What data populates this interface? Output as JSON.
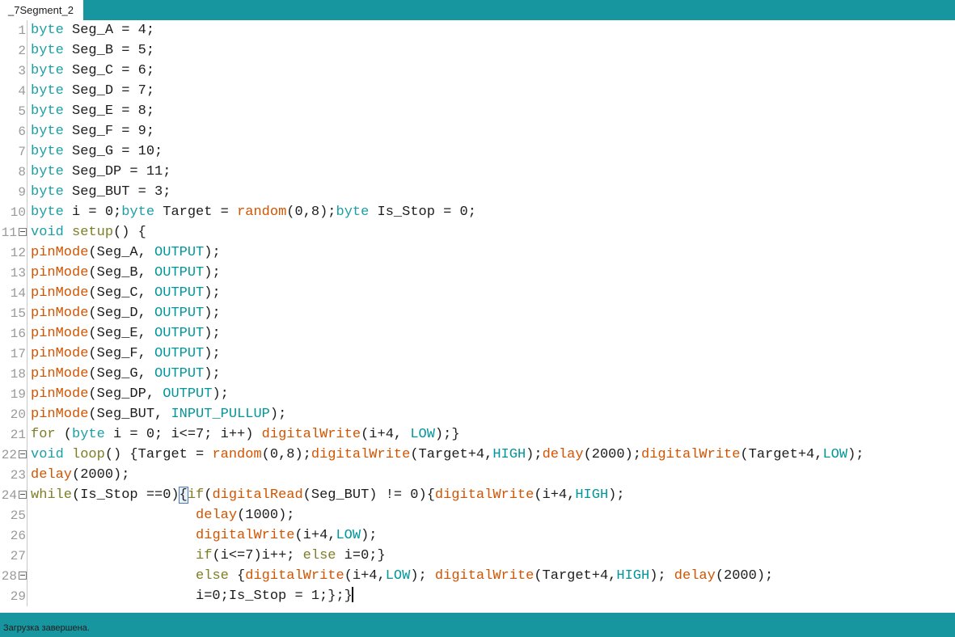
{
  "window": {
    "accent_teal": "#1896a0",
    "background": "#ffffff"
  },
  "tabbar": {
    "tabs": [
      {
        "label": "_7Segment_2",
        "active": true
      }
    ]
  },
  "editor": {
    "font": "monospace",
    "brace_match_highlight": "{",
    "caret_line": 29,
    "lines": [
      {
        "n": "1",
        "fold": false,
        "text": "byte Seg_A = 4;"
      },
      {
        "n": "2",
        "fold": false,
        "text": "byte Seg_B = 5;"
      },
      {
        "n": "3",
        "fold": false,
        "text": "byte Seg_C = 6;"
      },
      {
        "n": "4",
        "fold": false,
        "text": "byte Seg_D = 7;"
      },
      {
        "n": "5",
        "fold": false,
        "text": "byte Seg_E = 8;"
      },
      {
        "n": "6",
        "fold": false,
        "text": "byte Seg_F = 9;"
      },
      {
        "n": "7",
        "fold": false,
        "text": "byte Seg_G = 10;"
      },
      {
        "n": "8",
        "fold": false,
        "text": "byte Seg_DP = 11;"
      },
      {
        "n": "9",
        "fold": false,
        "text": "byte Seg_BUT = 3;"
      },
      {
        "n": "10",
        "fold": false,
        "text": "byte i = 0;byte Target = random(0,8);byte Is_Stop = 0;"
      },
      {
        "n": "11",
        "fold": true,
        "text": "void setup() {"
      },
      {
        "n": "12",
        "fold": false,
        "text": "pinMode(Seg_A, OUTPUT);"
      },
      {
        "n": "13",
        "fold": false,
        "text": "pinMode(Seg_B, OUTPUT);"
      },
      {
        "n": "14",
        "fold": false,
        "text": "pinMode(Seg_C, OUTPUT);"
      },
      {
        "n": "15",
        "fold": false,
        "text": "pinMode(Seg_D, OUTPUT);"
      },
      {
        "n": "16",
        "fold": false,
        "text": "pinMode(Seg_E, OUTPUT);"
      },
      {
        "n": "17",
        "fold": false,
        "text": "pinMode(Seg_F, OUTPUT);"
      },
      {
        "n": "18",
        "fold": false,
        "text": "pinMode(Seg_G, OUTPUT);"
      },
      {
        "n": "19",
        "fold": false,
        "text": "pinMode(Seg_DP, OUTPUT);"
      },
      {
        "n": "20",
        "fold": false,
        "text": "pinMode(Seg_BUT, INPUT_PULLUP);"
      },
      {
        "n": "21",
        "fold": false,
        "text": "for (byte i = 0; i<=7; i++) digitalWrite(i+4, LOW);}"
      },
      {
        "n": "22",
        "fold": true,
        "text": "void loop() {Target = random(0,8);digitalWrite(Target+4,HIGH);delay(2000);digitalWrite(Target+4,LOW);"
      },
      {
        "n": "23",
        "fold": false,
        "text": "delay(2000);"
      },
      {
        "n": "24",
        "fold": true,
        "text": "while(Is_Stop ==0){if(digitalRead(Seg_BUT) != 0){digitalWrite(i+4,HIGH);"
      },
      {
        "n": "25",
        "fold": false,
        "text": "                    delay(1000);"
      },
      {
        "n": "26",
        "fold": false,
        "text": "                    digitalWrite(i+4,LOW);"
      },
      {
        "n": "27",
        "fold": false,
        "text": "                    if(i<=7)i++; else i=0;}"
      },
      {
        "n": "28",
        "fold": true,
        "text": "                    else {digitalWrite(i+4,LOW); digitalWrite(Target+4,HIGH); delay(2000);"
      },
      {
        "n": "29",
        "fold": false,
        "text": "                    i=0;Is_Stop = 1;};}"
      }
    ],
    "tokens": {
      "keywords": [
        "byte",
        "void"
      ],
      "control": [
        "for",
        "if",
        "else",
        "while"
      ],
      "functions": [
        "pinMode",
        "digitalWrite",
        "digitalRead",
        "random",
        "delay"
      ],
      "identifiers": [
        "setup",
        "loop"
      ],
      "constants": [
        "OUTPUT",
        "INPUT_PULLUP",
        "HIGH",
        "LOW"
      ]
    },
    "colors": {
      "keyword": "#1b9fa6",
      "control": "#7e7e24",
      "function": "#d35400",
      "constant": "#00979c",
      "plain": "#1d1d1d",
      "line_number": "#9a9a9a"
    }
  },
  "statusbar": {
    "message": "Загрузка завершена."
  }
}
